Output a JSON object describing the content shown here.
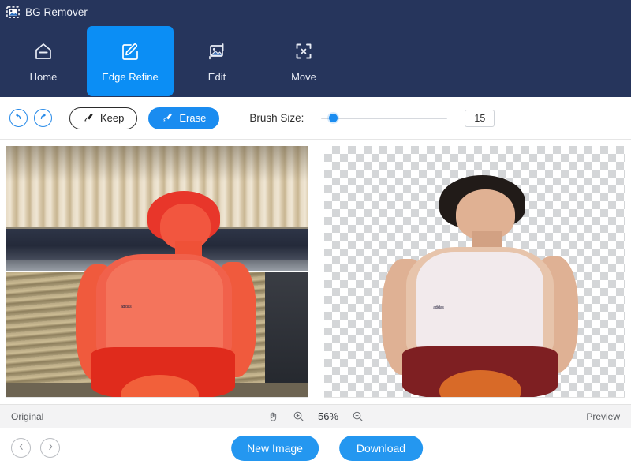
{
  "app": {
    "title": "BG Remover",
    "title_icon": "image-placeholder-icon",
    "header_bg": "#26355c",
    "accent": "#0b8ef5"
  },
  "nav": {
    "items": [
      {
        "label": "Home",
        "icon": "home-icon",
        "active": false
      },
      {
        "label": "Edge Refine",
        "icon": "edit-pen-square-icon",
        "active": true
      },
      {
        "label": "Edit",
        "icon": "image-edit-icon",
        "active": false
      },
      {
        "label": "Move",
        "icon": "move-arrows-icon",
        "active": false
      }
    ]
  },
  "toolbar": {
    "undo_icon": "undo-arrow-icon",
    "redo_icon": "redo-arrow-icon",
    "keep_label": "Keep",
    "keep_icon": "brush-keep-icon",
    "erase_label": "Erase",
    "erase_icon": "brush-erase-icon",
    "brush_size_label": "Brush Size:",
    "brush_size_value": "15",
    "slider_min": "1",
    "slider_max": "100",
    "slider_position_pct": "8"
  },
  "canvas": {
    "left_pane": {
      "name": "Original",
      "mask_color": "#ff5a3c",
      "description": "Photo of a young man seated on bleachers in a white tank top with red shorts; the subject is covered by a red selection mask."
    },
    "right_pane": {
      "name": "Preview",
      "checker_light": "#ffffff",
      "checker_dark": "#d4d6d8",
      "description": "Cut-out of the same subject over a transparency checkerboard."
    },
    "brand_text": "adidas"
  },
  "statusbar": {
    "left_label": "Original",
    "right_label": "Preview",
    "hand_icon": "hand-pan-icon",
    "zoom_in_icon": "zoom-in-icon",
    "zoom_out_icon": "zoom-out-icon",
    "zoom_value": "56%"
  },
  "footer": {
    "prev_icon": "chevron-left-icon",
    "next_icon": "chevron-right-icon",
    "new_image_label": "New Image",
    "download_label": "Download",
    "button_color": "#2497f0"
  }
}
